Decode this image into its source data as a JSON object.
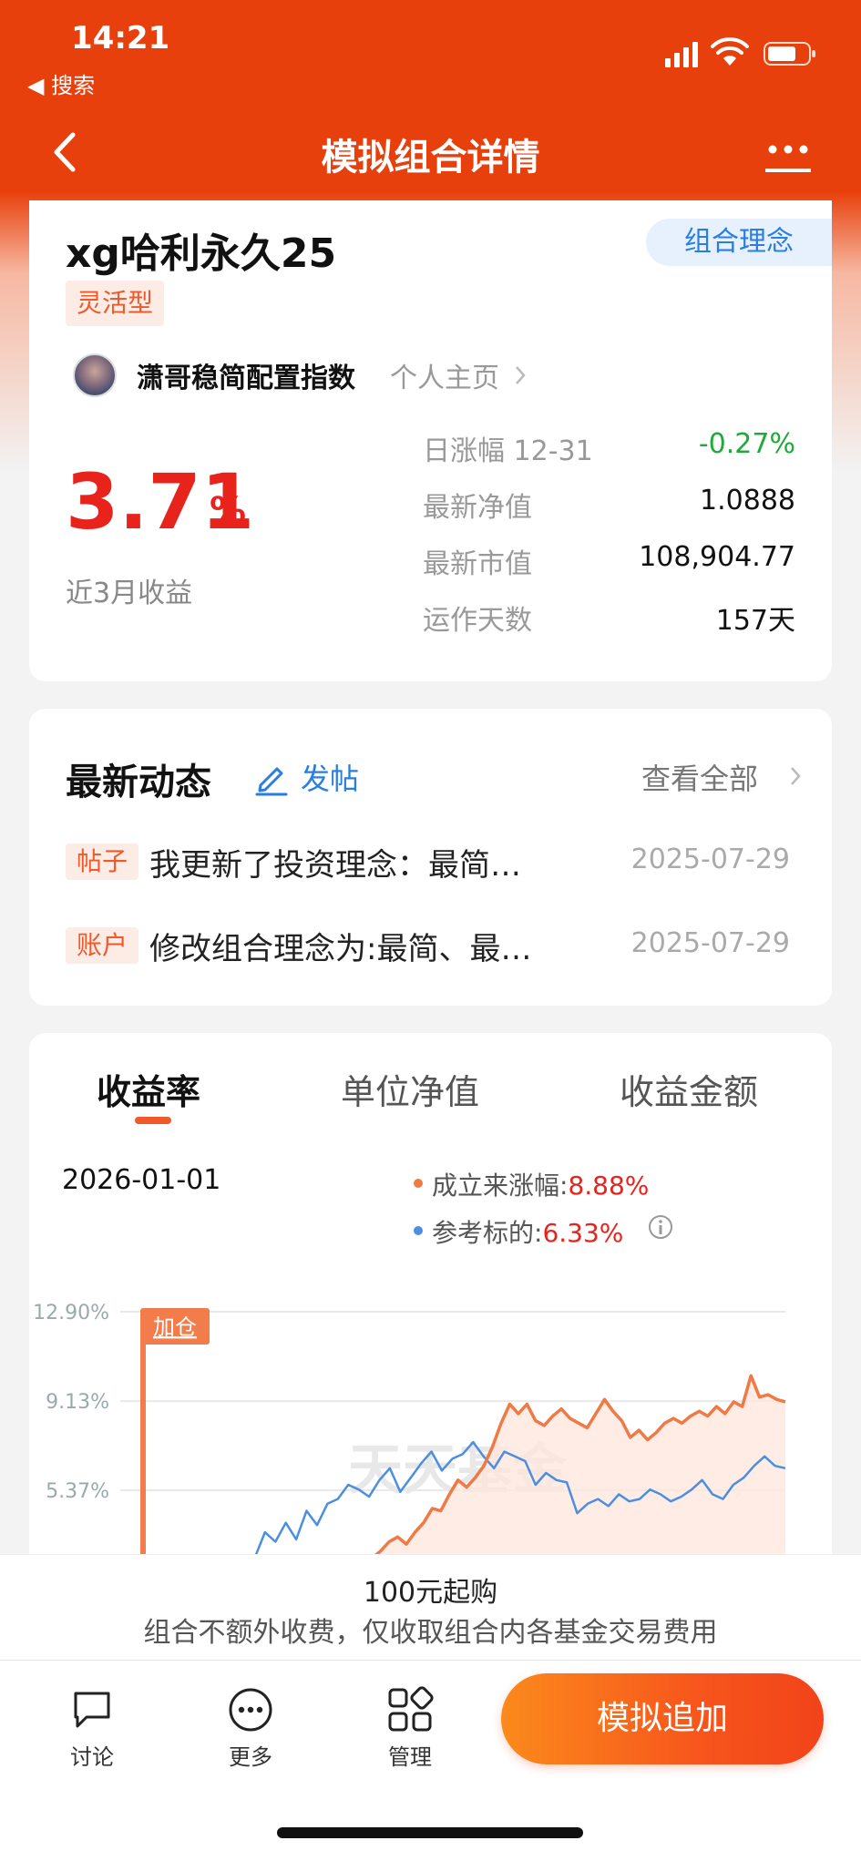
{
  "status_bar": {
    "time": "14:21",
    "back_app": "◀ 搜索",
    "icons": [
      "signal-icon",
      "wifi-icon",
      "battery-icon"
    ]
  },
  "nav": {
    "title": "模拟组合详情",
    "back_icon": "chevron-left-icon",
    "more_icon": "more-icon"
  },
  "portfolio": {
    "name": "xg哈利永久25",
    "concept_button": "组合理念",
    "type_tag": "灵活型",
    "owner": "潇哥稳简配置指数",
    "homepage_link": "个人主页",
    "return_value": "3.71",
    "return_unit": "%",
    "return_label": "近3月收益",
    "stats": [
      {
        "label": "日涨幅 12-31",
        "value": "-0.27%"
      },
      {
        "label": "最新净值",
        "value": "1.0888"
      },
      {
        "label": "最新市值",
        "value": "108,904.77"
      },
      {
        "label": "运作天数",
        "value": "157天"
      }
    ]
  },
  "news": {
    "title": "最新动态",
    "post_label": "发帖",
    "view_all": "查看全部",
    "items": [
      {
        "tag": "帖子",
        "text": "我更新了投资理念：最简…",
        "date": "2025-07-29"
      },
      {
        "tag": "账户",
        "text": "修改组合理念为:最简、最…",
        "date": "2025-07-29"
      }
    ]
  },
  "chart_tabs": [
    "收益率",
    "单位净值",
    "收益金额"
  ],
  "chart_header": {
    "date": "2026-01-01",
    "legend": [
      {
        "label": "成立来涨幅:",
        "value": "8.88%",
        "color": "#f07a46"
      },
      {
        "label": "参考标的:",
        "value": "6.33%",
        "color": "#4c8fe0"
      }
    ]
  },
  "chart_data": {
    "type": "line",
    "yticks": [
      "12.90%",
      "9.13%",
      "5.37%"
    ],
    "ylim": [
      1.5,
      12.9
    ],
    "grid": true,
    "marker_label": "加仓",
    "watermark": "天天基金",
    "series": [
      {
        "name": "成立来涨幅",
        "color": "#f07a46",
        "values": [
          1.6,
          1.4,
          1.5,
          1.7,
          1.9,
          2.3,
          2.2,
          2.5,
          2.8,
          3.2,
          3.4,
          3.1,
          3.6,
          4.0,
          4.6,
          4.5,
          5.2,
          5.8,
          5.5,
          5.9,
          6.4,
          7.2,
          8.2,
          9.0,
          8.6,
          9.0,
          8.3,
          8.1,
          8.5,
          8.8,
          8.4,
          8.2,
          8.0,
          8.6,
          9.2,
          8.7,
          8.3,
          7.6,
          7.9,
          7.5,
          7.8,
          8.2,
          8.4,
          8.2,
          8.5,
          8.7,
          8.5,
          8.9,
          8.6,
          9.1,
          8.9,
          10.2,
          9.3,
          9.4,
          9.2,
          9.1
        ]
      },
      {
        "name": "参考标的",
        "color": "#4c8fe0",
        "values": [
          1.8,
          2.5,
          3.6,
          3.2,
          4.0,
          3.3,
          4.5,
          3.9,
          4.8,
          5.0,
          5.6,
          5.4,
          5.1,
          5.8,
          6.3,
          5.3,
          5.9,
          6.5,
          7.0,
          6.2,
          6.7,
          6.9,
          7.4,
          6.8,
          6.3,
          7.0,
          6.8,
          6.6,
          5.6,
          6.1,
          5.8,
          5.7,
          4.4,
          4.8,
          5.0,
          4.7,
          5.2,
          4.9,
          5.0,
          5.4,
          5.2,
          4.9,
          5.1,
          5.4,
          5.8,
          5.2,
          5.0,
          5.6,
          5.9,
          6.4,
          6.8,
          6.4,
          6.3
        ]
      }
    ]
  },
  "banner": {
    "line1": "100元起购",
    "line2": "组合不额外收费，仅收取组合内各基金交易费用"
  },
  "bottom_bar": {
    "items": [
      {
        "label": "讨论",
        "icon": "chat-icon"
      },
      {
        "label": "更多",
        "icon": "more-circle-icon"
      },
      {
        "label": "管理",
        "icon": "grid-icon"
      }
    ],
    "cta": "模拟追加"
  }
}
